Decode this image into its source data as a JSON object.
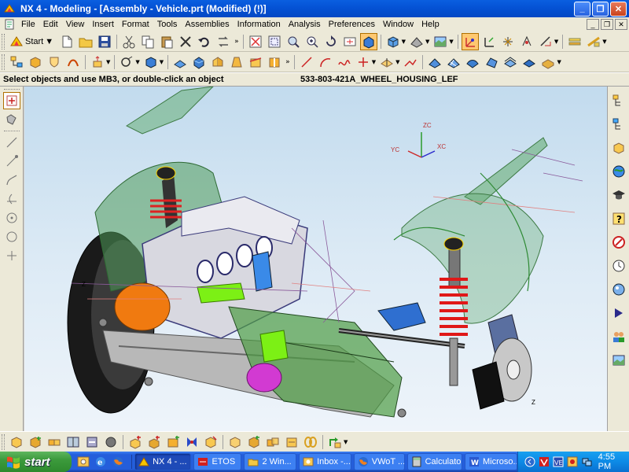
{
  "window": {
    "title": "NX 4 - Modeling - [Assembly - Vehicle.prt (Modified)     (!)]"
  },
  "menubar": {
    "items": [
      "File",
      "Edit",
      "View",
      "Insert",
      "Format",
      "Tools",
      "Assemblies",
      "Information",
      "Analysis",
      "Preferences",
      "Window",
      "Help"
    ]
  },
  "toolbar": {
    "start_label": "Start"
  },
  "cueline": {
    "cue": "Select objects and use MB3, or double-click an object",
    "status": "533-803-421A_WHEEL_HOUSING_LEF"
  },
  "graphics": {
    "triad": {
      "zc": "ZC",
      "yc": "YC",
      "xc": "XC"
    },
    "axis_z_left": "Z",
    "axis_z_right": "Z"
  },
  "taskbar": {
    "start": "start",
    "tasks": [
      {
        "label": "NX 4 - ...",
        "icon": "nx-icon",
        "active": true
      },
      {
        "label": "ETOS",
        "icon": "etos-icon",
        "active": false
      },
      {
        "label": "2 Win...",
        "icon": "folder-icon",
        "active": false
      },
      {
        "label": "Inbox -...",
        "icon": "outlook-icon",
        "active": false
      },
      {
        "label": "VWoT ...",
        "icon": "firefox-icon",
        "active": false
      },
      {
        "label": "Calculator",
        "icon": "calculator-icon",
        "active": false
      },
      {
        "label": "Microso...",
        "icon": "word-icon",
        "active": false
      }
    ],
    "clock": "4:55 PM"
  },
  "colors": {
    "titlebar": "#0553d6",
    "viewport_top": "#c2dbee",
    "viewport_bottom": "#eef4fa",
    "taskbar": "#245edb",
    "start_green": "#3c9a3c"
  }
}
